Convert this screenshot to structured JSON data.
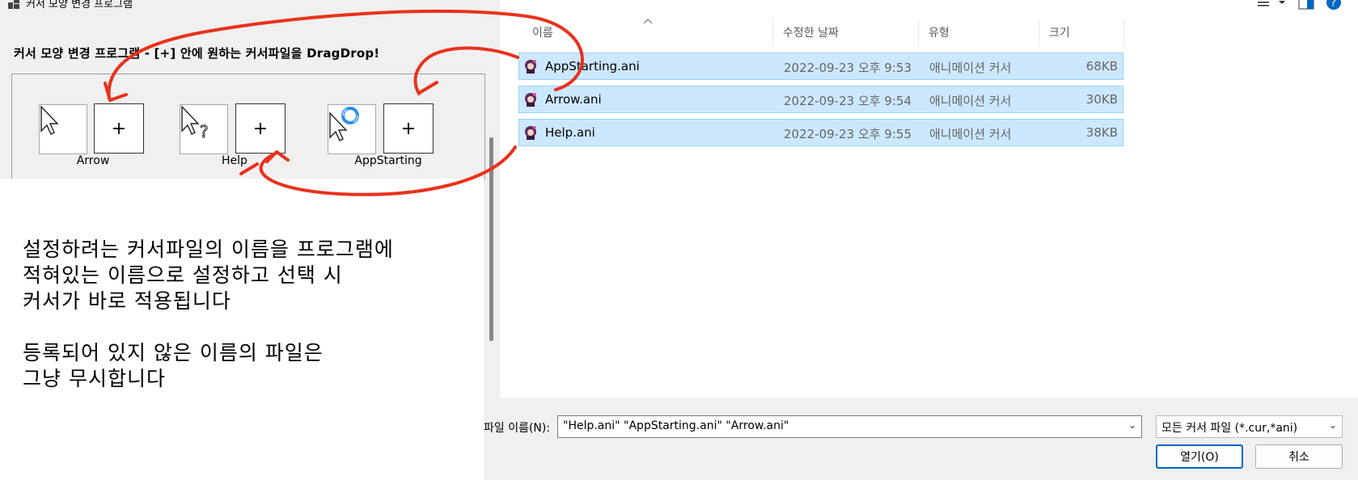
{
  "app": {
    "title": "커서 모양 변경 프로그램",
    "instruction": "커서 모양 변경 프로그램 - [+] 안에 원하는 커서파일을 DragDrop!",
    "slots": [
      {
        "label": "Arrow",
        "plus": "+"
      },
      {
        "label": "Help",
        "plus": "+"
      },
      {
        "label": "AppStarting",
        "plus": "+"
      }
    ]
  },
  "note": {
    "lines": [
      "설정하려는 커서파일의 이름을 프로그램에",
      "적혀있는 이름으로 설정하고 선택 시",
      "커서가 바로 적용됩니다",
      "등록되어 있지 않은 이름의 파일은",
      "그냥 무시합니다"
    ]
  },
  "dialog": {
    "columns": [
      "이름",
      "수정한 날짜",
      "유형",
      "크기"
    ],
    "files": [
      {
        "name": "AppStarting.ani",
        "date": "2022-09-23 오후 9:53",
        "type": "애니메이션 커서",
        "size": "68KB"
      },
      {
        "name": "Arrow.ani",
        "date": "2022-09-23 오후 9:54",
        "type": "애니메이션 커서",
        "size": "30KB"
      },
      {
        "name": "Help.ani",
        "date": "2022-09-23 오후 9:55",
        "type": "애니메이션 커서",
        "size": "38KB"
      }
    ],
    "filename_label": "파일 이름(N):",
    "filename_value": "\"Help.ani\" \"AppStarting.ani\" \"Arrow.ani\"",
    "filter_value": "모든 커서 파일 (*.cur,*ani)",
    "open_label": "열기(O)",
    "cancel_label": "취소"
  },
  "colors": {
    "accent": "#0067c0",
    "selection": "#cce8ff",
    "annotation": "#e8321c"
  }
}
